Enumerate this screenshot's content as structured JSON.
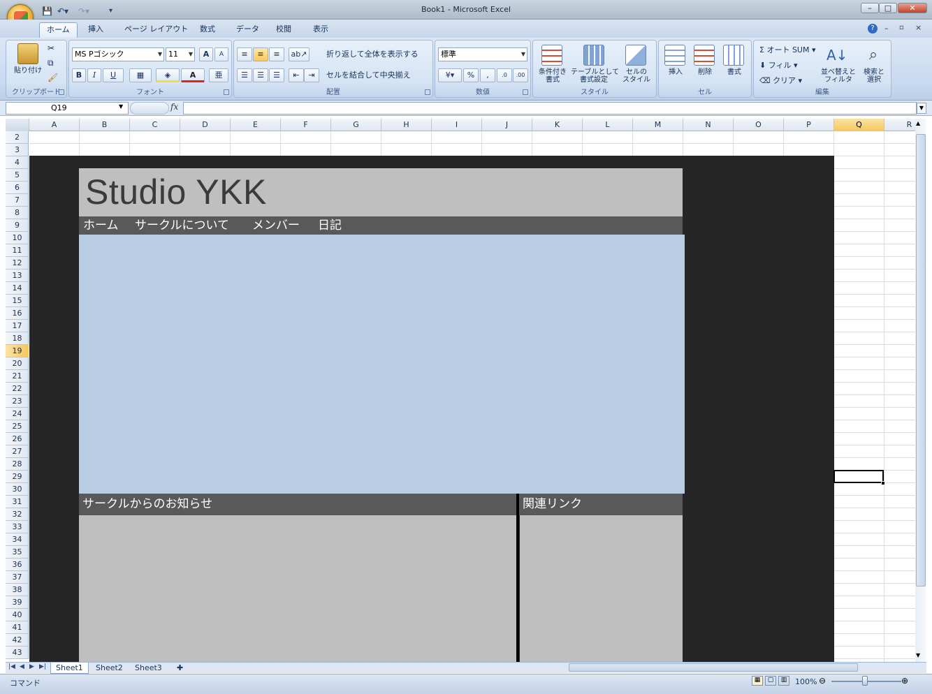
{
  "window": {
    "title": "Book1 - Microsoft Excel",
    "minimize": "–",
    "maximize": "□",
    "close": "✕"
  },
  "tabs": [
    "ホーム",
    "挿入",
    "ページ レイアウト",
    "数式",
    "データ",
    "校閲",
    "表示"
  ],
  "ribbon": {
    "clipboard": {
      "label": "クリップボード",
      "paste": "貼り付け"
    },
    "font": {
      "label": "フォント",
      "name": "MS Pゴシック",
      "size": "11",
      "bold": "B",
      "italic": "I",
      "underline": "U"
    },
    "alignment": {
      "label": "配置",
      "wrap": "折り返して全体を表示する",
      "merge": "セルを結合して中央揃え"
    },
    "number": {
      "label": "数値",
      "format": "標準",
      "percent": "%",
      "comma": ","
    },
    "styles": {
      "label": "スタイル",
      "conditional": "条件付き\n書式",
      "table": "テーブルとして\n書式設定",
      "cell": "セルの\nスタイル"
    },
    "cells": {
      "label": "セル",
      "insert": "挿入",
      "delete": "削除",
      "format": "書式"
    },
    "editing": {
      "label": "編集",
      "autosum": "オート SUM",
      "fill": "フィル",
      "clear": "クリア",
      "sort": "並べ替えと\nフィルタ",
      "find": "検索と\n選択"
    }
  },
  "formula_bar": {
    "name_box": "Q19",
    "fx": "fx",
    "formula": ""
  },
  "grid": {
    "columns": [
      "A",
      "B",
      "C",
      "D",
      "E",
      "F",
      "G",
      "H",
      "I",
      "J",
      "K",
      "L",
      "M",
      "N",
      "O",
      "P",
      "Q",
      "R"
    ],
    "selected_column": "Q",
    "rows": [
      "2",
      "3",
      "4",
      "5",
      "6",
      "7",
      "8",
      "9",
      "10",
      "11",
      "12",
      "13",
      "14",
      "15",
      "16",
      "17",
      "18",
      "19",
      "20",
      "21",
      "22",
      "23",
      "24",
      "25",
      "26",
      "27",
      "28",
      "29",
      "30",
      "31",
      "32",
      "33",
      "34",
      "35",
      "36",
      "37",
      "38",
      "39",
      "40",
      "41",
      "42",
      "43"
    ],
    "selected_row": "19"
  },
  "mockup": {
    "site_title": "Studio YKK",
    "nav": [
      "ホーム",
      "サークルについて",
      "メンバー",
      "日記"
    ],
    "news_heading": "サークルからのお知らせ",
    "links_heading": "関連リンク"
  },
  "sheets": [
    "Sheet1",
    "Sheet2",
    "Sheet3"
  ],
  "status": {
    "mode": "コマンド",
    "zoom": "100%"
  },
  "colors": {
    "mockup_bg": "#262626",
    "header_gray": "#bfbfbf",
    "nav_gray": "#595959",
    "main_blue": "#b8cce4",
    "selection_orange": "#f6c65c"
  }
}
